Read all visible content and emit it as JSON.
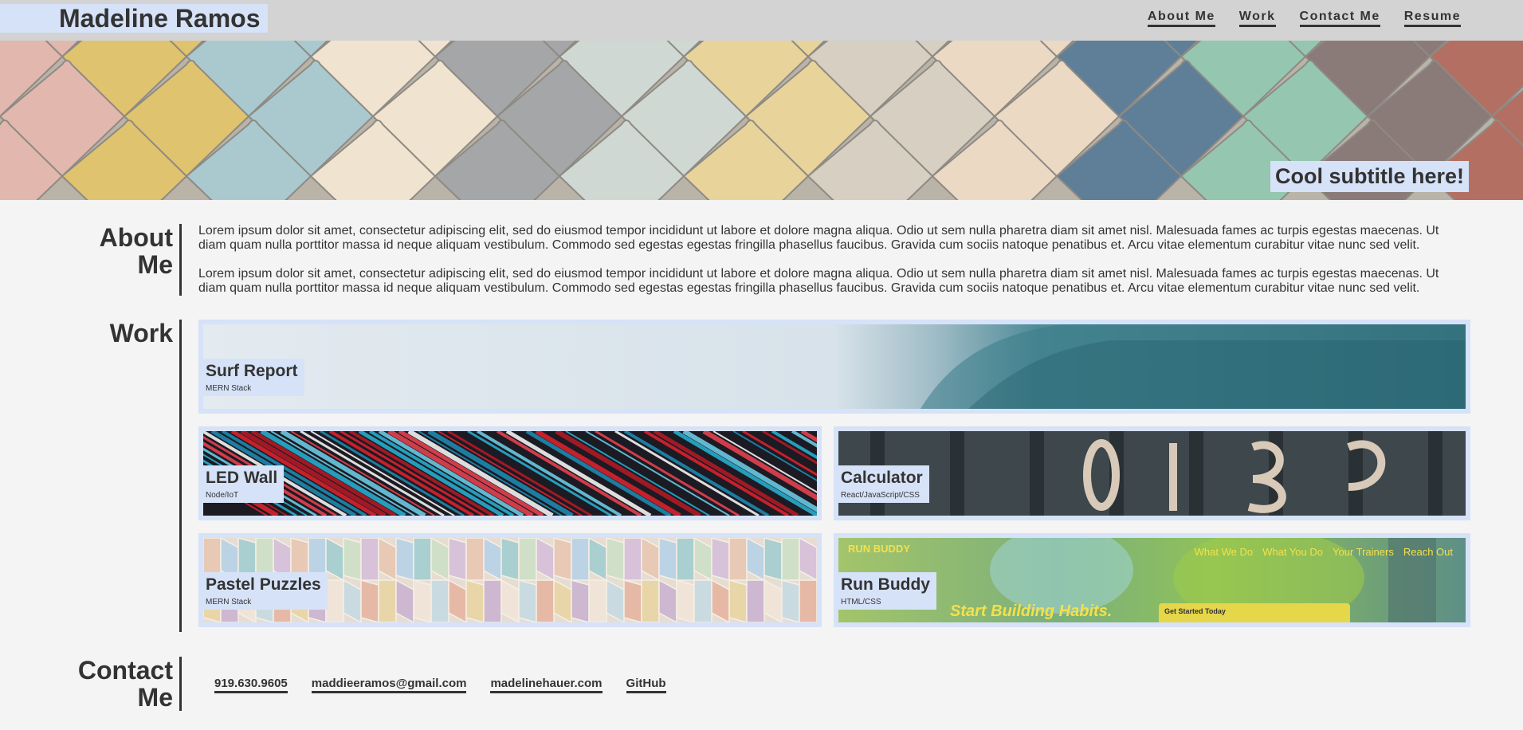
{
  "header": {
    "name": "Madeline Ramos",
    "nav": [
      "About Me",
      "Work",
      "Contact Me",
      "Resume"
    ]
  },
  "hero": {
    "subtitle": "Cool subtitle here!"
  },
  "about": {
    "title_line1": "About",
    "title_line2": "Me",
    "paragraphs": [
      "Lorem ipsum dolor sit amet, consectetur adipiscing elit, sed do eiusmod tempor incididunt ut labore et dolore magna aliqua. Odio ut sem nulla pharetra diam sit amet nisl. Malesuada fames ac turpis egestas maecenas. Ut diam quam nulla porttitor massa id neque aliquam vestibulum. Commodo sed egestas egestas fringilla phasellus faucibus. Gravida cum sociis natoque penatibus et. Arcu vitae elementum curabitur vitae nunc sed velit.",
      "Lorem ipsum dolor sit amet, consectetur adipiscing elit, sed do eiusmod tempor incididunt ut labore et dolore magna aliqua. Odio ut sem nulla pharetra diam sit amet nisl. Malesuada fames ac turpis egestas maecenas. Ut diam quam nulla porttitor massa id neque aliquam vestibulum. Commodo sed egestas egestas fringilla phasellus faucibus. Gravida cum sociis natoque penatibus et. Arcu vitae elementum curabitur vitae nunc sed velit."
    ]
  },
  "work": {
    "title": "Work",
    "projects": [
      {
        "title": "Surf Report",
        "stack": "MERN Stack"
      },
      {
        "title": "LED Wall",
        "stack": "Node/IoT"
      },
      {
        "title": "Calculator",
        "stack": "React/JavaScript/CSS"
      },
      {
        "title": "Pastel Puzzles",
        "stack": "MERN Stack"
      },
      {
        "title": "Run Buddy",
        "stack": "HTML/CSS"
      }
    ],
    "runbuddy_preview": {
      "logo": "RUN BUDDY",
      "nav": [
        "What We Do",
        "What You Do",
        "Your Trainers",
        "Reach Out"
      ],
      "tagline": "Start Building Habits.",
      "cta": "Get Started Today"
    }
  },
  "contact": {
    "title_line1": "Contact",
    "title_line2": "Me",
    "links": [
      "919.630.9605",
      "maddieeramos@gmail.com",
      "madelinehauer.com",
      "GitHub"
    ]
  }
}
